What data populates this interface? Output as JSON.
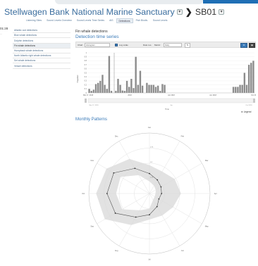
{
  "app": {
    "title": "Stellwagen Bank National Marine Sanctuary",
    "title_dropdown": "▾",
    "breadcrumb_arrow": "❯",
    "site": "SB01",
    "site_dropdown": "▾"
  },
  "tabs": [
    {
      "label": "Listening Sites",
      "active": false
    },
    {
      "label": "Sound Levels Overview",
      "active": false
    },
    {
      "label": "Sound Levels Time Series",
      "active": false
    },
    {
      "label": "AIS",
      "active": false
    },
    {
      "label": "Detections",
      "active": true
    },
    {
      "label": "Fish Biodiv.",
      "active": false
    },
    {
      "label": "Sound Levels",
      "active": false
    }
  ],
  "left_edge": {
    "value": "01:28",
    "sub": "..."
  },
  "sidebar": {
    "items": [
      {
        "label": "Atlantic cod detections",
        "active": false
      },
      {
        "label": "Blue whale detections",
        "active": false
      },
      {
        "label": "Dolphin detections",
        "active": false
      },
      {
        "label": "Fin whale detections",
        "active": true
      },
      {
        "label": "Humpback whale detections",
        "active": false
      },
      {
        "label": "North Atlantic right whale detections",
        "active": false
      },
      {
        "label": "Sei whale detections",
        "active": false
      },
      {
        "label": "Vessel detections",
        "active": false
      }
    ]
  },
  "page": {
    "title": "Fin whale detections",
    "subtitle": "Detection time series",
    "monthly_title": "Monthly Patterns"
  },
  "toolbar": {
    "chart_label": "Chart",
    "chart_value": "Histogram",
    "log_scale_label": "Log scale",
    "date_label": "Date res.",
    "date_value": "Daily",
    "metric_label": "Metric:",
    "metric_value": "Daily",
    "pin_icon": "✎",
    "download_icon": "⬇",
    "grid_icon": "▦"
  },
  "chart_data": [
    {
      "type": "bar",
      "x_tick_labels": [
        "Mar 17, 2018",
        "2018",
        "Apr 2018",
        "Jun 2018",
        "Oct 2018"
      ],
      "y_ticks": [
        0,
        0.1,
        0.2,
        0.3,
        0.4,
        0.5,
        0.6,
        0.7,
        0.8,
        0.9,
        1.0
      ],
      "ylim": [
        0,
        1.0
      ],
      "ylabel": "Proportion",
      "xlabel": "Time",
      "values": [
        0.1,
        0.05,
        0.08,
        0.22,
        0.25,
        0.3,
        0.45,
        0.2,
        0.1,
        0.92,
        0.05,
        0,
        0.05,
        0.35,
        0.2,
        0.06,
        0.05,
        0.3,
        0.15,
        0.35,
        0.12,
        0.9,
        0.2,
        0.55,
        0.18,
        0,
        0.25,
        0.2,
        0.2,
        0.2,
        0.15,
        0.18,
        0.05,
        0.22,
        0.2,
        0,
        0,
        0,
        0,
        0,
        0,
        0,
        0,
        0,
        0,
        0,
        0,
        0,
        0,
        0,
        0,
        0,
        0,
        0,
        0,
        0,
        0,
        0,
        0,
        0,
        0,
        0,
        0,
        0,
        0,
        0.15,
        0.15,
        0.15,
        0.2,
        0.2,
        0.5,
        0.2,
        0.7,
        0.75,
        0.8
      ],
      "navigator_labels": [
        "Mar 17, 2018",
        "Jun",
        "Oct 2018"
      ]
    },
    {
      "type": "radar",
      "categories": [
        "Jan",
        "Feb",
        "Mar",
        "Apr",
        "May",
        "Jun",
        "Jul",
        "Aug",
        "Sep",
        "Oct",
        "Nov",
        "Dec"
      ],
      "r_ticks": [
        "0.25",
        "0.5",
        "0.75"
      ],
      "rlim": [
        0,
        1
      ],
      "mean": [
        0.33,
        0.26,
        0.22,
        0.2,
        0.18,
        0.25,
        0.35,
        0.45,
        0.65,
        0.7,
        0.68,
        0.48
      ],
      "upper": [
        0.47,
        0.42,
        0.48,
        0.52,
        0.45,
        0.42,
        0.43,
        0.6,
        0.85,
        0.88,
        0.82,
        0.66
      ],
      "lower": [
        0.2,
        0.15,
        0.12,
        0.1,
        0.1,
        0.12,
        0.25,
        0.32,
        0.52,
        0.55,
        0.55,
        0.35
      ]
    }
  ],
  "legend_button": "⚙ Legend"
}
